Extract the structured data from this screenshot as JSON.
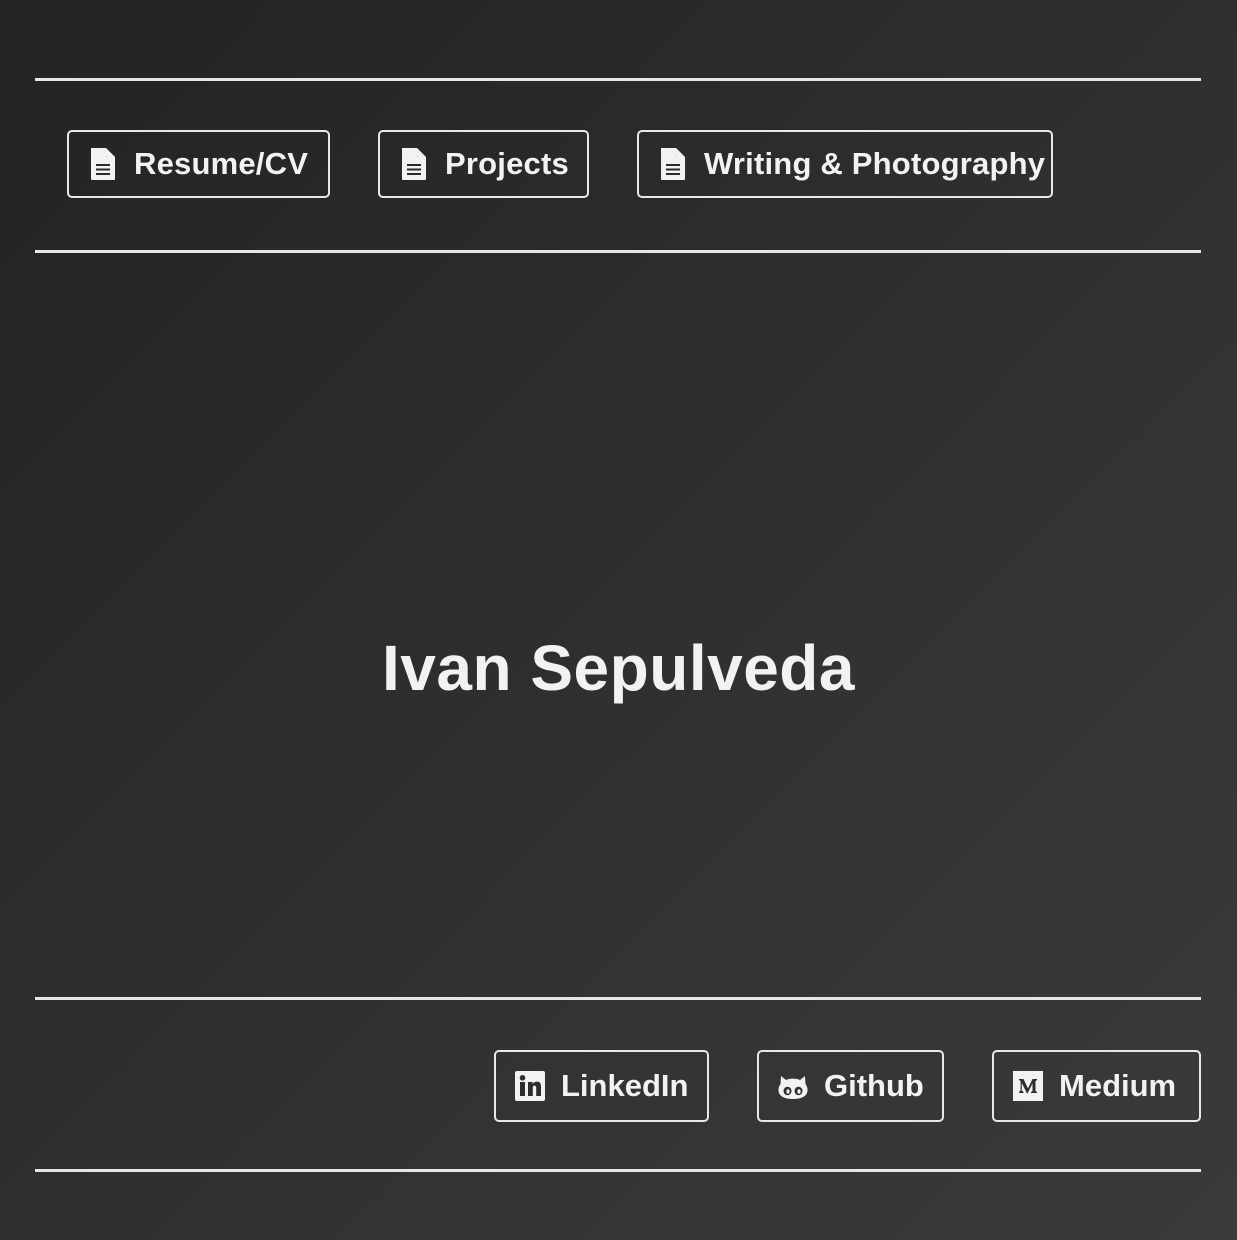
{
  "nav": {
    "items": [
      {
        "label": "Resume/CV",
        "icon": "document-icon"
      },
      {
        "label": "Projects",
        "icon": "document-icon"
      },
      {
        "label": "Writing & Photography",
        "icon": "document-icon"
      }
    ]
  },
  "hero": {
    "name": "Ivan Sepulveda"
  },
  "social": {
    "items": [
      {
        "label": "LinkedIn",
        "icon": "linkedin-icon"
      },
      {
        "label": "Github",
        "icon": "github-icon"
      },
      {
        "label": "Medium",
        "icon": "medium-icon"
      }
    ]
  },
  "colors": {
    "text": "#f2f2f2",
    "border": "#e8e8e8",
    "background_start": "#242223",
    "background_end": "#3c3a39"
  }
}
